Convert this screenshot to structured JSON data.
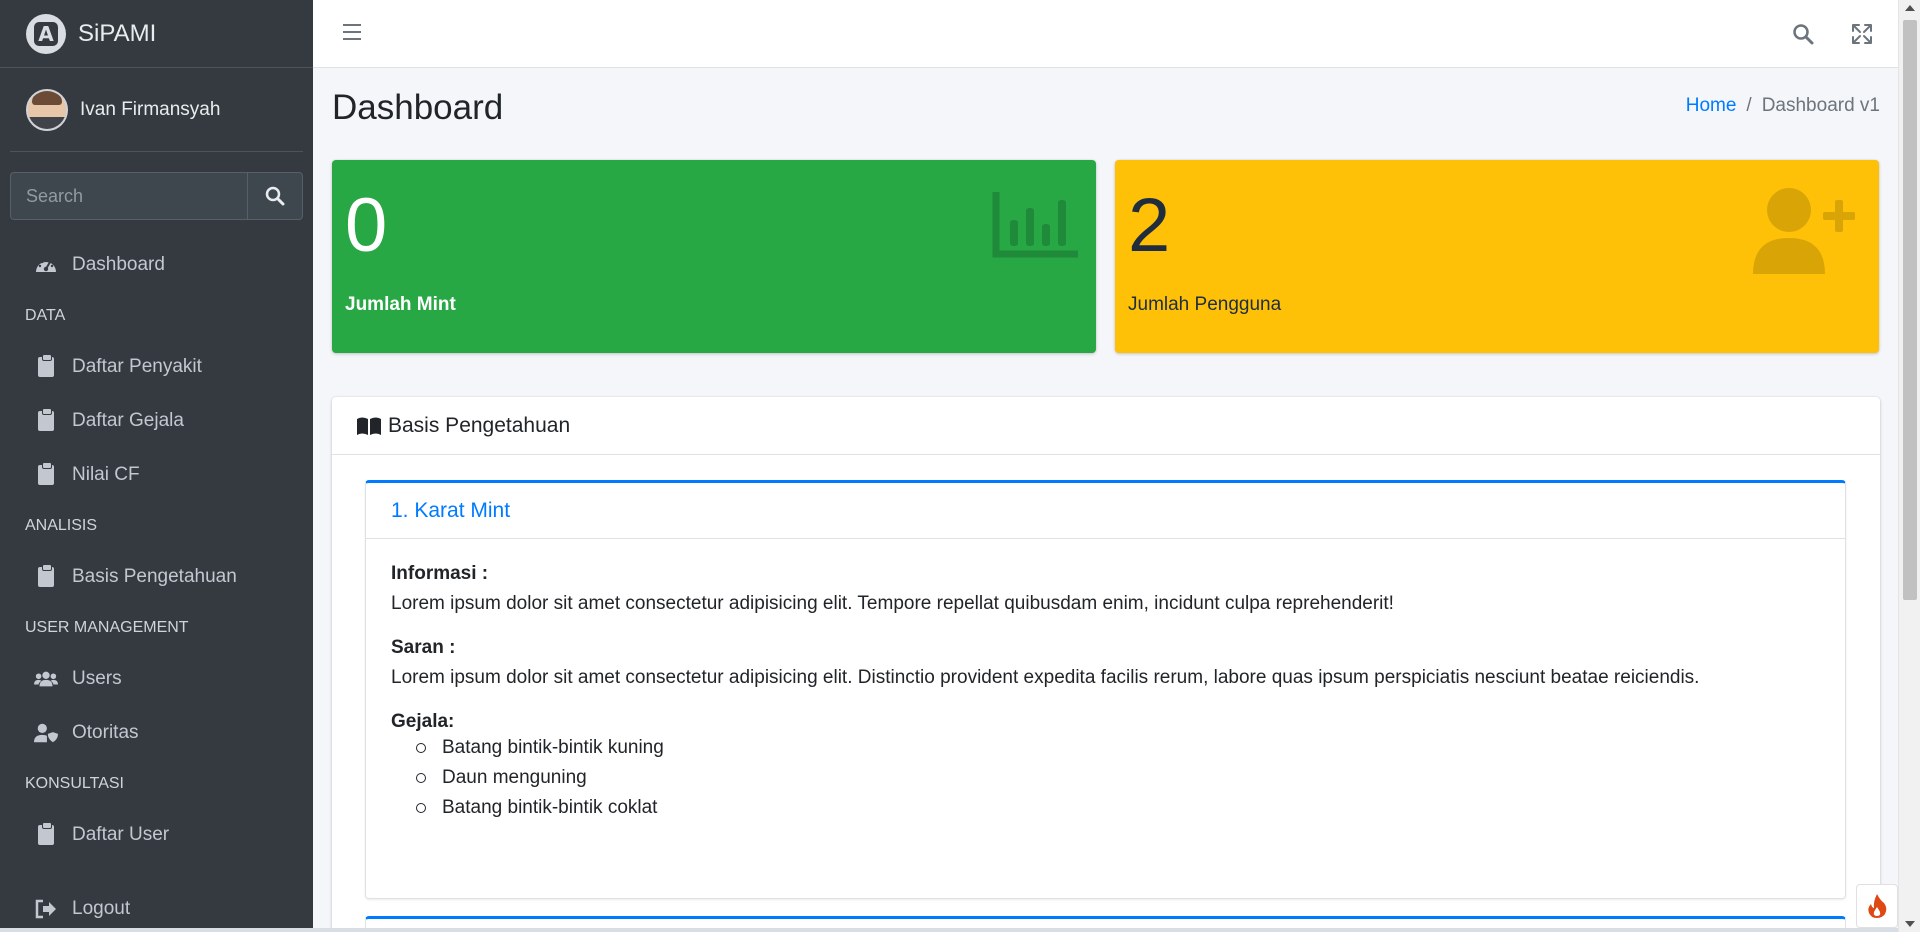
{
  "brand": {
    "name": "SiPAMI"
  },
  "user": {
    "name": "Ivan Firmansyah"
  },
  "search": {
    "placeholder": "Search"
  },
  "sidebar": {
    "dashboard": "Dashboard",
    "sections": [
      {
        "header": "DATA",
        "items": [
          "Daftar Penyakit",
          "Daftar Gejala",
          "Nilai CF"
        ]
      },
      {
        "header": "ANALISIS",
        "items": [
          "Basis Pengetahuan"
        ]
      },
      {
        "header": "USER MANAGEMENT",
        "items": [
          "Users",
          "Otoritas"
        ]
      },
      {
        "header": "KONSULTASI",
        "items": [
          "Daftar User"
        ]
      }
    ],
    "logout": "Logout"
  },
  "page": {
    "title": "Dashboard",
    "breadcrumb": {
      "home": "Home",
      "separator": "/",
      "current": "Dashboard v1"
    }
  },
  "stats": [
    {
      "value": "0",
      "label": "Jumlah Mint",
      "icon": "chart-bar-icon",
      "color": "#28a745"
    },
    {
      "value": "2",
      "label": "Jumlah Pengguna",
      "icon": "user-plus-icon",
      "color": "#ffc107"
    }
  ],
  "knowledge": {
    "title": "Basis Pengetahuan",
    "items": [
      {
        "title": "1. Karat Mint",
        "info_label": "Informasi :",
        "info": "Lorem ipsum dolor sit amet consectetur adipisicing elit. Tempore repellat quibusdam enim, incidunt culpa reprehenderit!",
        "saran_label": "Saran :",
        "saran": "Lorem ipsum dolor sit amet consectetur adipisicing elit. Distinctio provident expedita facilis rerum, labore quas ipsum perspiciatis nesciunt beatae reiciendis.",
        "gejala_label": "Gejala:",
        "gejala": [
          "Batang bintik-bintik kuning",
          "Daun menguning",
          "Batang bintik-bintik coklat"
        ]
      }
    ]
  },
  "colors": {
    "sidebar": "#343a40",
    "accent": "#007bff",
    "success": "#28a745",
    "warning": "#ffc107"
  }
}
